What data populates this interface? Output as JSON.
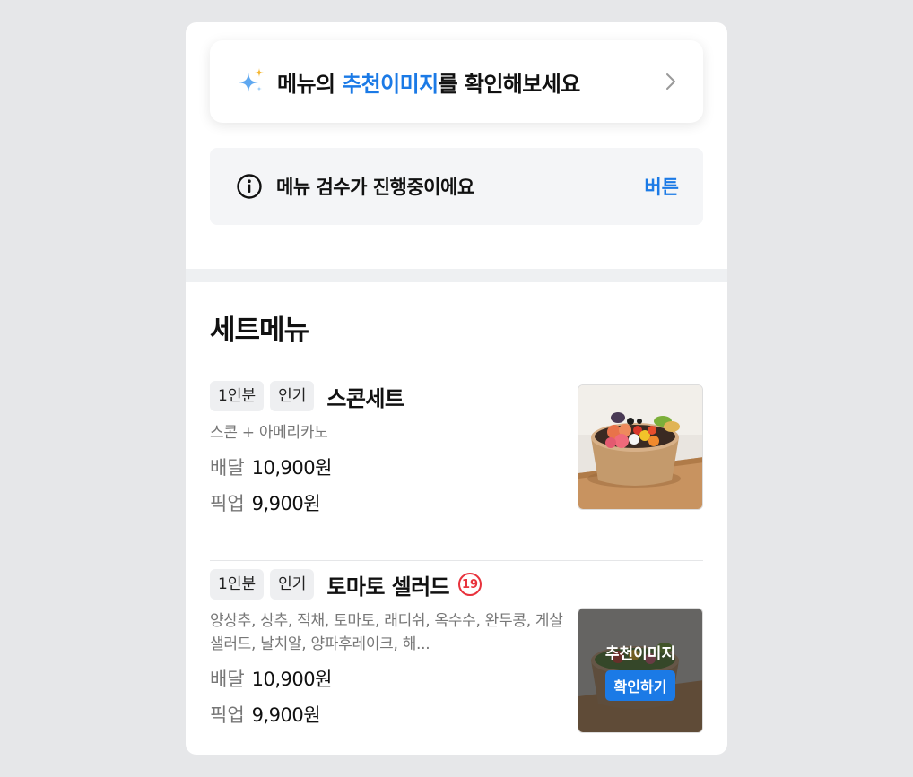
{
  "banner": {
    "text_pre": "메뉴의 ",
    "text_highlight": "추천이미지",
    "text_post": "를 확인해보세요"
  },
  "notice": {
    "text": "메뉴 검수가 진행중이에요",
    "button_label": "버튼"
  },
  "section": {
    "title": "세트메뉴"
  },
  "items": [
    {
      "tags": [
        "1인분",
        "인기"
      ],
      "name": "스콘세트",
      "description": "스콘 + 아메리카노",
      "delivery_label": "배달",
      "delivery_price": "10,900원",
      "pickup_label": "픽업",
      "pickup_price": "9,900원"
    },
    {
      "tags": [
        "1인분",
        "인기"
      ],
      "name": "토마토 셀러드",
      "age_badge": "19",
      "description": "양상추, 상추, 적채, 토마토, 래디쉬, 옥수수, 완두콩, 게살샐러드, 날치알, 양파후레이크, 해...",
      "delivery_label": "배달",
      "delivery_price": "10,900원",
      "pickup_label": "픽업",
      "pickup_price": "9,900원",
      "overlay_text": "추천이미지",
      "overlay_button": "확인하기"
    }
  ],
  "colors": {
    "accent": "#1b7ae6",
    "age_badge": "#e8323c",
    "background": "#e6e7e9"
  },
  "icons": {
    "banner": "sparkle-icon",
    "banner_arrow": "chevron-right-icon",
    "notice": "info-icon"
  }
}
